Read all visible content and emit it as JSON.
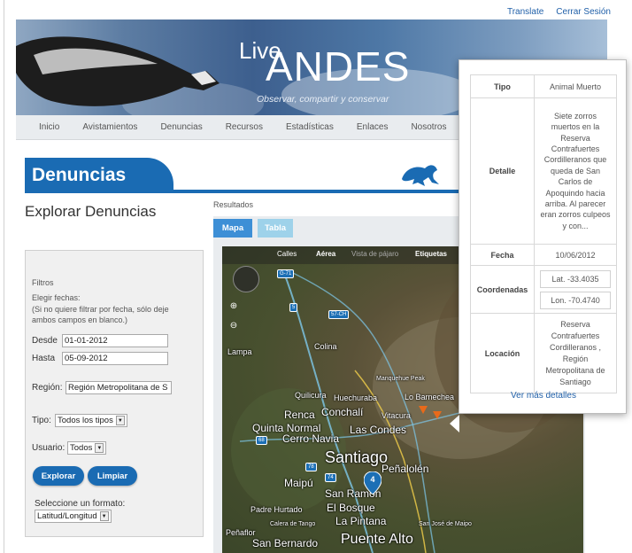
{
  "header_links": {
    "translate": "Translate",
    "logout": "Cerrar Sesión"
  },
  "logo": {
    "live": "Live",
    "andes": "ANDES",
    "tagline": "Observar, compartir y conservar"
  },
  "nav": [
    "Inicio",
    "Avistamientos",
    "Denuncias",
    "Recursos",
    "Estadísticas",
    "Enlaces",
    "Nosotros"
  ],
  "section_title": "Denuncias",
  "page_heading": "Explorar Denuncias",
  "results_label": "Resultados",
  "filters": {
    "title": "Filtros",
    "dates_label": "Elegir fechas:",
    "dates_hint": "(Si no quiere filtrar por fecha, sólo deje ambos campos en blanco.)",
    "desde_label": "Desde",
    "desde_value": "01-01-2012",
    "hasta_label": "Hasta",
    "hasta_value": "05-09-2012",
    "region_label": "Región:",
    "region_value": "Región Metropolitana de S",
    "tipo_label": "Tipo:",
    "tipo_value": "Todos los tipos",
    "usuario_label": "Usuario:",
    "usuario_value": "Todos",
    "explorar_button": "Explorar",
    "limpiar_button": "Limpiar",
    "format_label": "Seleccione un formato:",
    "format_value": "Latitud/Longitud"
  },
  "tabs": {
    "map": "Mapa",
    "table": "Tabla"
  },
  "map": {
    "toolbar": {
      "calles": "Calles",
      "aerea": "Aérea",
      "vista": "Vista de pájaro",
      "etiquetas": "Etiquetas"
    },
    "places": {
      "lampa": "Lampa",
      "colina": "Colina",
      "quilicura": "Quilicura",
      "huechuraba": "Huechuraba",
      "lo_barnechea": "Lo Barnechea",
      "renca": "Renca",
      "conchali": "Conchalí",
      "vitacura": "Vitacura",
      "quinta_normal": "Quinta Normal",
      "las_condes": "Las Condes",
      "cerro_navia": "Cerro Navia",
      "santiago": "Santiago",
      "penalolen": "Peñalolén",
      "maipu": "Maipú",
      "san_ramon": "San Ramón",
      "el_bosque": "El Bosque",
      "la_pintana": "La Pintana",
      "padre_hurtado": "Padre Hurtado",
      "penaflor": "Peñaflor",
      "calera_de_tango": "Calera de Tango",
      "san_bernardo": "San Bernardo",
      "puente_alto": "Puente Alto",
      "san_jose_de_maipo": "San José de Maipo",
      "manquehue_peak": "Manquehue Peak"
    },
    "shields": {
      "g71": "G-71",
      "r5": "5",
      "r57ch": "57-CH",
      "r68": "68",
      "r78": "78",
      "r74": "74"
    },
    "cluster_count": "4"
  },
  "popup": {
    "tipo_label": "Tipo",
    "tipo_value": "Animal Muerto",
    "detalle_label": "Detalle",
    "detalle_value": "Siete zorros muertos en la Reserva Contrafuertes Cordilleranos que queda de San Carlos de Apoquindo hacia arriba. Al parecer eran zorros culpeos y con...",
    "fecha_label": "Fecha",
    "fecha_value": "10/06/2012",
    "coords_label": "Coordenadas",
    "lat_value": "Lat. -33.4035",
    "lon_value": "Lon. -70.4740",
    "location_label": "Locación",
    "location_value": "Reserva Contrafuertes Cordilleranos , Región Metropolitana de Santiago",
    "more_link": "Ver más detalles"
  }
}
